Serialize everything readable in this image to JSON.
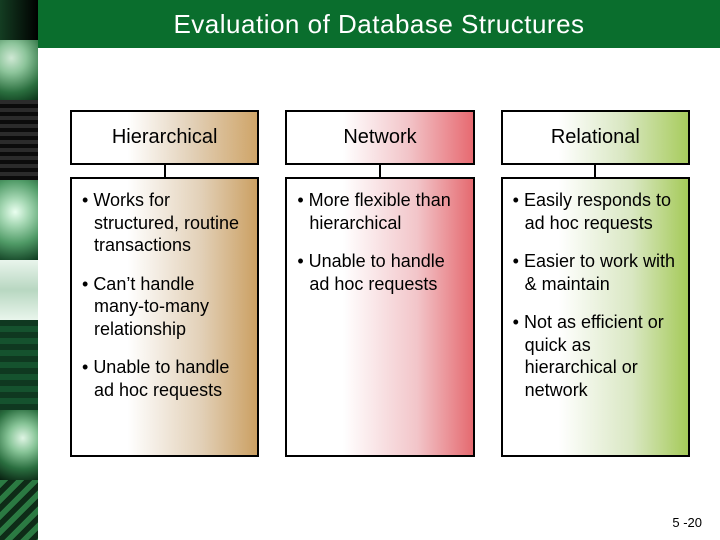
{
  "title": "Evaluation of Database Structures",
  "columns": [
    {
      "header": "Hierarchical",
      "points": [
        "Works for structured, routine transactions",
        "Can’t handle many-to-many relationship",
        "Unable to handle ad hoc requests"
      ]
    },
    {
      "header": "Network",
      "points": [
        "More flexible than hierarchical",
        "Unable to handle ad hoc requests"
      ]
    },
    {
      "header": "Relational",
      "points": [
        "Easily responds to ad hoc requests",
        "Easier to work with & maintain",
        "Not as efficient or quick as hierarchical or network"
      ]
    }
  ],
  "footer": "5 -20",
  "bullet": "• "
}
